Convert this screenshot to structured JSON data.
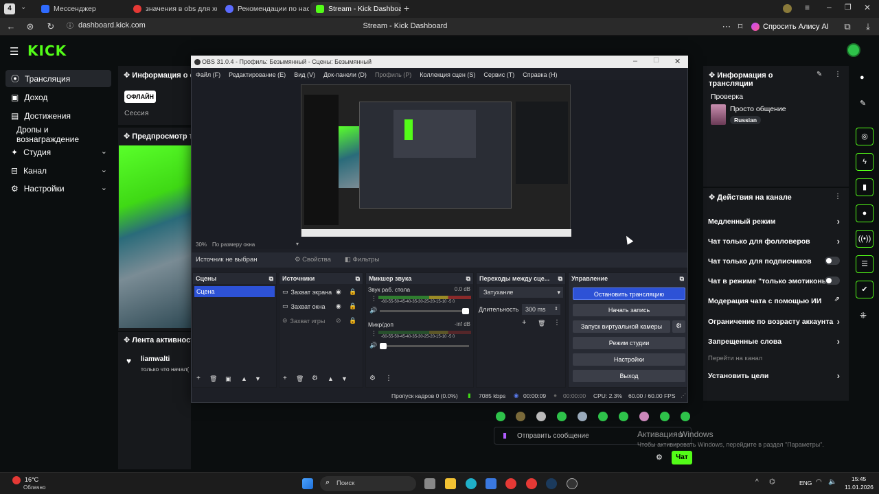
{
  "browser": {
    "tabs": [
      {
        "label": "Мессенджер",
        "color": "#2f6bff"
      },
      {
        "label": "значения в obs для хоро",
        "color": "#e53935"
      },
      {
        "label": "Рекомендации по настро",
        "color": "#5b6bff"
      },
      {
        "label": "Stream - Kick Dashboard",
        "color": "#53fc18"
      }
    ],
    "url": "dashboard.kick.com",
    "title": "Stream - Kick Dashboard",
    "alice_label": "Спросить Алису AI"
  },
  "kick": {
    "logo": "KICK",
    "sidebar": [
      {
        "label": "Трансляция",
        "icon": "broadcast-icon"
      },
      {
        "label": "Доход",
        "icon": "money-icon"
      },
      {
        "label": "Достижения",
        "icon": "trophy-icon"
      },
      {
        "label": "Дропы и вознаграждение",
        "icon": ""
      },
      {
        "label": "Студия",
        "icon": "studio-icon",
        "chevron": true
      },
      {
        "label": "Канал",
        "icon": "channel-icon",
        "chevron": true
      },
      {
        "label": "Настройки",
        "icon": "gear-icon",
        "chevron": true
      }
    ],
    "stream_info_title": "Информация о се",
    "offline_badge": "ОФЛАЙН",
    "session_label": "Сессия",
    "preview_title": "Предпросмотр тр",
    "activity_title": "Лента активности",
    "activity_user": "liamwalti",
    "activity_text": "только что начал(",
    "right_panel": {
      "title": "Информация о трансляции",
      "check_label": "Проверка",
      "stream_title": "Просто общение",
      "language": "Russian"
    },
    "actions": {
      "title": "Действия на канале",
      "items": [
        {
          "label": "Медленный режим",
          "kind": "chevron"
        },
        {
          "label": "Чат только для фолловеров",
          "kind": "chevron"
        },
        {
          "label": "Чат только для подписчиков",
          "kind": "toggle"
        },
        {
          "label": "Чат в режиме \"только эмотиконы\"",
          "kind": "toggle"
        },
        {
          "label": "Модерация чата с помощью ИИ",
          "kind": "external"
        },
        {
          "label": "Ограничение по возрасту аккаунта",
          "kind": "chevron"
        },
        {
          "label": "Запрещенные слова",
          "kind": "chevron"
        },
        {
          "label": "Перейти на канал",
          "kind": "muted"
        },
        {
          "label": "Установить цели",
          "kind": "chevron"
        }
      ]
    },
    "chat_placeholder": "Отправить сообщение",
    "chat_button": "Чат"
  },
  "obs": {
    "title": "OBS 31.0.4 - Профиль: Безымянный - Сцены: Безымянный",
    "menu": [
      "Файл (F)",
      "Редактирование (E)",
      "Вид (V)",
      "Док-панели (D)",
      "Профиль (P)",
      "Коллекция сцен (S)",
      "Сервис (T)",
      "Справка (H)"
    ],
    "zoom": "30%",
    "fit_label": "По размеру окна",
    "no_source": "Источник не выбран",
    "properties_btn": "Свойства",
    "filters_btn": "Фильтры",
    "docks": {
      "scenes": "Сцены",
      "sources": "Источники",
      "mixer": "Микшер звука",
      "transitions": "Переходы между сце...",
      "controls": "Управление"
    },
    "scenes": [
      "Сцена"
    ],
    "sources": [
      {
        "label": "Захват экрана"
      },
      {
        "label": "Захват окна"
      },
      {
        "label": "Захват игры"
      }
    ],
    "mixer": [
      {
        "name": "Звук раб. стола",
        "db": "0.0 dB"
      },
      {
        "name": "Микр/доп",
        "db": "-inf dB"
      }
    ],
    "meter_scale": "-60-55-50-45-40-35-30-25-20-15-10 -5 0",
    "transition_type": "Затухание",
    "duration_label": "Длительность",
    "duration_value": "300 ms",
    "controls": [
      "Остановить трансляцию",
      "Начать запись",
      "Запуск виртуальной камеры",
      "Режим студии",
      "Настройки",
      "Выход"
    ],
    "status": {
      "dropped": "Пропуск кадров 0 (0.0%)",
      "bitrate": "7085 kbps",
      "stream_time": "00:00:09",
      "rec_time": "00:00:00",
      "cpu": "CPU: 2.3%",
      "fps": "60.00 / 60.00 FPS"
    }
  },
  "windows": {
    "activate_title": "Активация Windows",
    "activate_text": "Чтобы активировать Windows, перейдите в раздел \"Параметры\".",
    "weather_temp": "16°C",
    "weather_text": "Облачно",
    "search_label": "Поиск",
    "lang": "ENG",
    "time": "15:45",
    "date": "11.01.2026"
  },
  "colors": {
    "kick_green": "#53fc18",
    "obs_blue": "#2d52d6"
  }
}
